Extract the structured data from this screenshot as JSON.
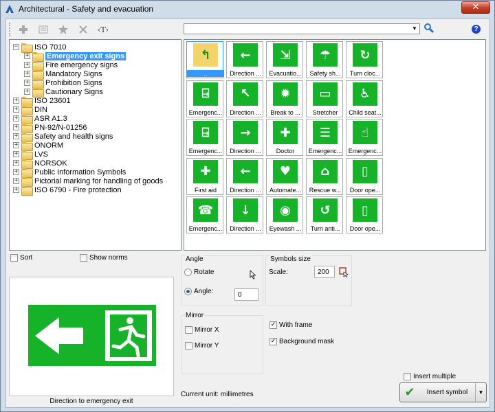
{
  "window": {
    "title": "Architectural - Safety and evacuation",
    "close_label": "✕"
  },
  "toolbar": {
    "items": [
      "add-icon",
      "properties-icon",
      "favorite-icon",
      "delete-icon",
      "text-icon"
    ],
    "text_label": "‹T›"
  },
  "search": {
    "value": "",
    "dropdown": "▼"
  },
  "help": {
    "label": "?"
  },
  "tree": {
    "items": [
      {
        "label": "ISO 7010",
        "exp": "−",
        "level": 0
      },
      {
        "label": "Emergency exit signs",
        "exp": "+",
        "level": 1,
        "selected": true
      },
      {
        "label": "Fire emergency signs",
        "exp": "+",
        "level": 1
      },
      {
        "label": "Mandatory Signs",
        "exp": "+",
        "level": 1
      },
      {
        "label": "Prohibition Signs",
        "exp": "+",
        "level": 1
      },
      {
        "label": "Cautionary Signs",
        "exp": "+",
        "level": 1
      },
      {
        "label": "ISO 23601",
        "exp": "+",
        "level": 0
      },
      {
        "label": "DIN",
        "exp": "+",
        "level": 0
      },
      {
        "label": "ASR A1.3",
        "exp": "+",
        "level": 0
      },
      {
        "label": "PN-92/N-01256",
        "exp": "+",
        "level": 0
      },
      {
        "label": "Safety and health signs",
        "exp": "+",
        "level": 0
      },
      {
        "label": "ÖNORM",
        "exp": "+",
        "level": 0
      },
      {
        "label": "LVS",
        "exp": "+",
        "level": 0
      },
      {
        "label": "NORSOK",
        "exp": "+",
        "level": 0
      },
      {
        "label": "Public Information Symbols",
        "exp": "+",
        "level": 0
      },
      {
        "label": "Pictorial marking for handling of goods",
        "exp": "+",
        "level": 0
      },
      {
        "label": "ISO 6790 - Fire protection",
        "exp": "+",
        "level": 0
      }
    ]
  },
  "symbols": [
    {
      "caption": "..",
      "glyph": "↰",
      "kind": "up"
    },
    {
      "caption": "Direction ...",
      "glyph": "←"
    },
    {
      "caption": "Evacuatio...",
      "glyph": "⇲"
    },
    {
      "caption": "Safety sh...",
      "glyph": "☂"
    },
    {
      "caption": "Turn cloc...",
      "glyph": "↻"
    },
    {
      "caption": "Emergenc...",
      "glyph": "⍈"
    },
    {
      "caption": "Direction ...",
      "glyph": "↖"
    },
    {
      "caption": "Break to ...",
      "glyph": "✹"
    },
    {
      "caption": "Stretcher",
      "glyph": "▭"
    },
    {
      "caption": "Child seat...",
      "glyph": "♿"
    },
    {
      "caption": "Emergenc...",
      "glyph": "⍈"
    },
    {
      "caption": "Direction ...",
      "glyph": "→"
    },
    {
      "caption": "Doctor",
      "glyph": "✚"
    },
    {
      "caption": "Emergenc...",
      "glyph": "☰"
    },
    {
      "caption": "Emergenc...",
      "glyph": "☝"
    },
    {
      "caption": "First aid",
      "glyph": "✚"
    },
    {
      "caption": "Direction ...",
      "glyph": "←"
    },
    {
      "caption": "Automate...",
      "glyph": "♥"
    },
    {
      "caption": "Rescue w...",
      "glyph": "⌂"
    },
    {
      "caption": "Door ope...",
      "glyph": "▯"
    },
    {
      "caption": "Emergenc...",
      "glyph": "☎"
    },
    {
      "caption": "Direction ...",
      "glyph": "↓"
    },
    {
      "caption": "Eyewash ...",
      "glyph": "◉"
    },
    {
      "caption": "Turn anti...",
      "glyph": "↺"
    },
    {
      "caption": "Door ope...",
      "glyph": "▯"
    }
  ],
  "options": {
    "sort_label": "Sort",
    "show_norms_label": "Show norms",
    "angle_group": "Angle",
    "rotate_label": "Rotate",
    "angle_label": "Angle:",
    "angle_value": "0",
    "size_group": "Symbols size",
    "scale_label": "Scale:",
    "scale_value": "200",
    "mirror_group": "Mirror",
    "mirror_x_label": "Mirror X",
    "mirror_y_label": "Mirror Y",
    "with_frame_label": "With frame",
    "background_mask_label": "Background mask",
    "insert_multiple_label": "Insert multiple",
    "current_unit": "Current unit: millimetres",
    "insert_symbol_label": "Insert symbol"
  },
  "preview": {
    "caption": "Direction to emergency exit"
  },
  "colors": {
    "sign_green": "#16b32a",
    "selection": "#3399ff"
  }
}
